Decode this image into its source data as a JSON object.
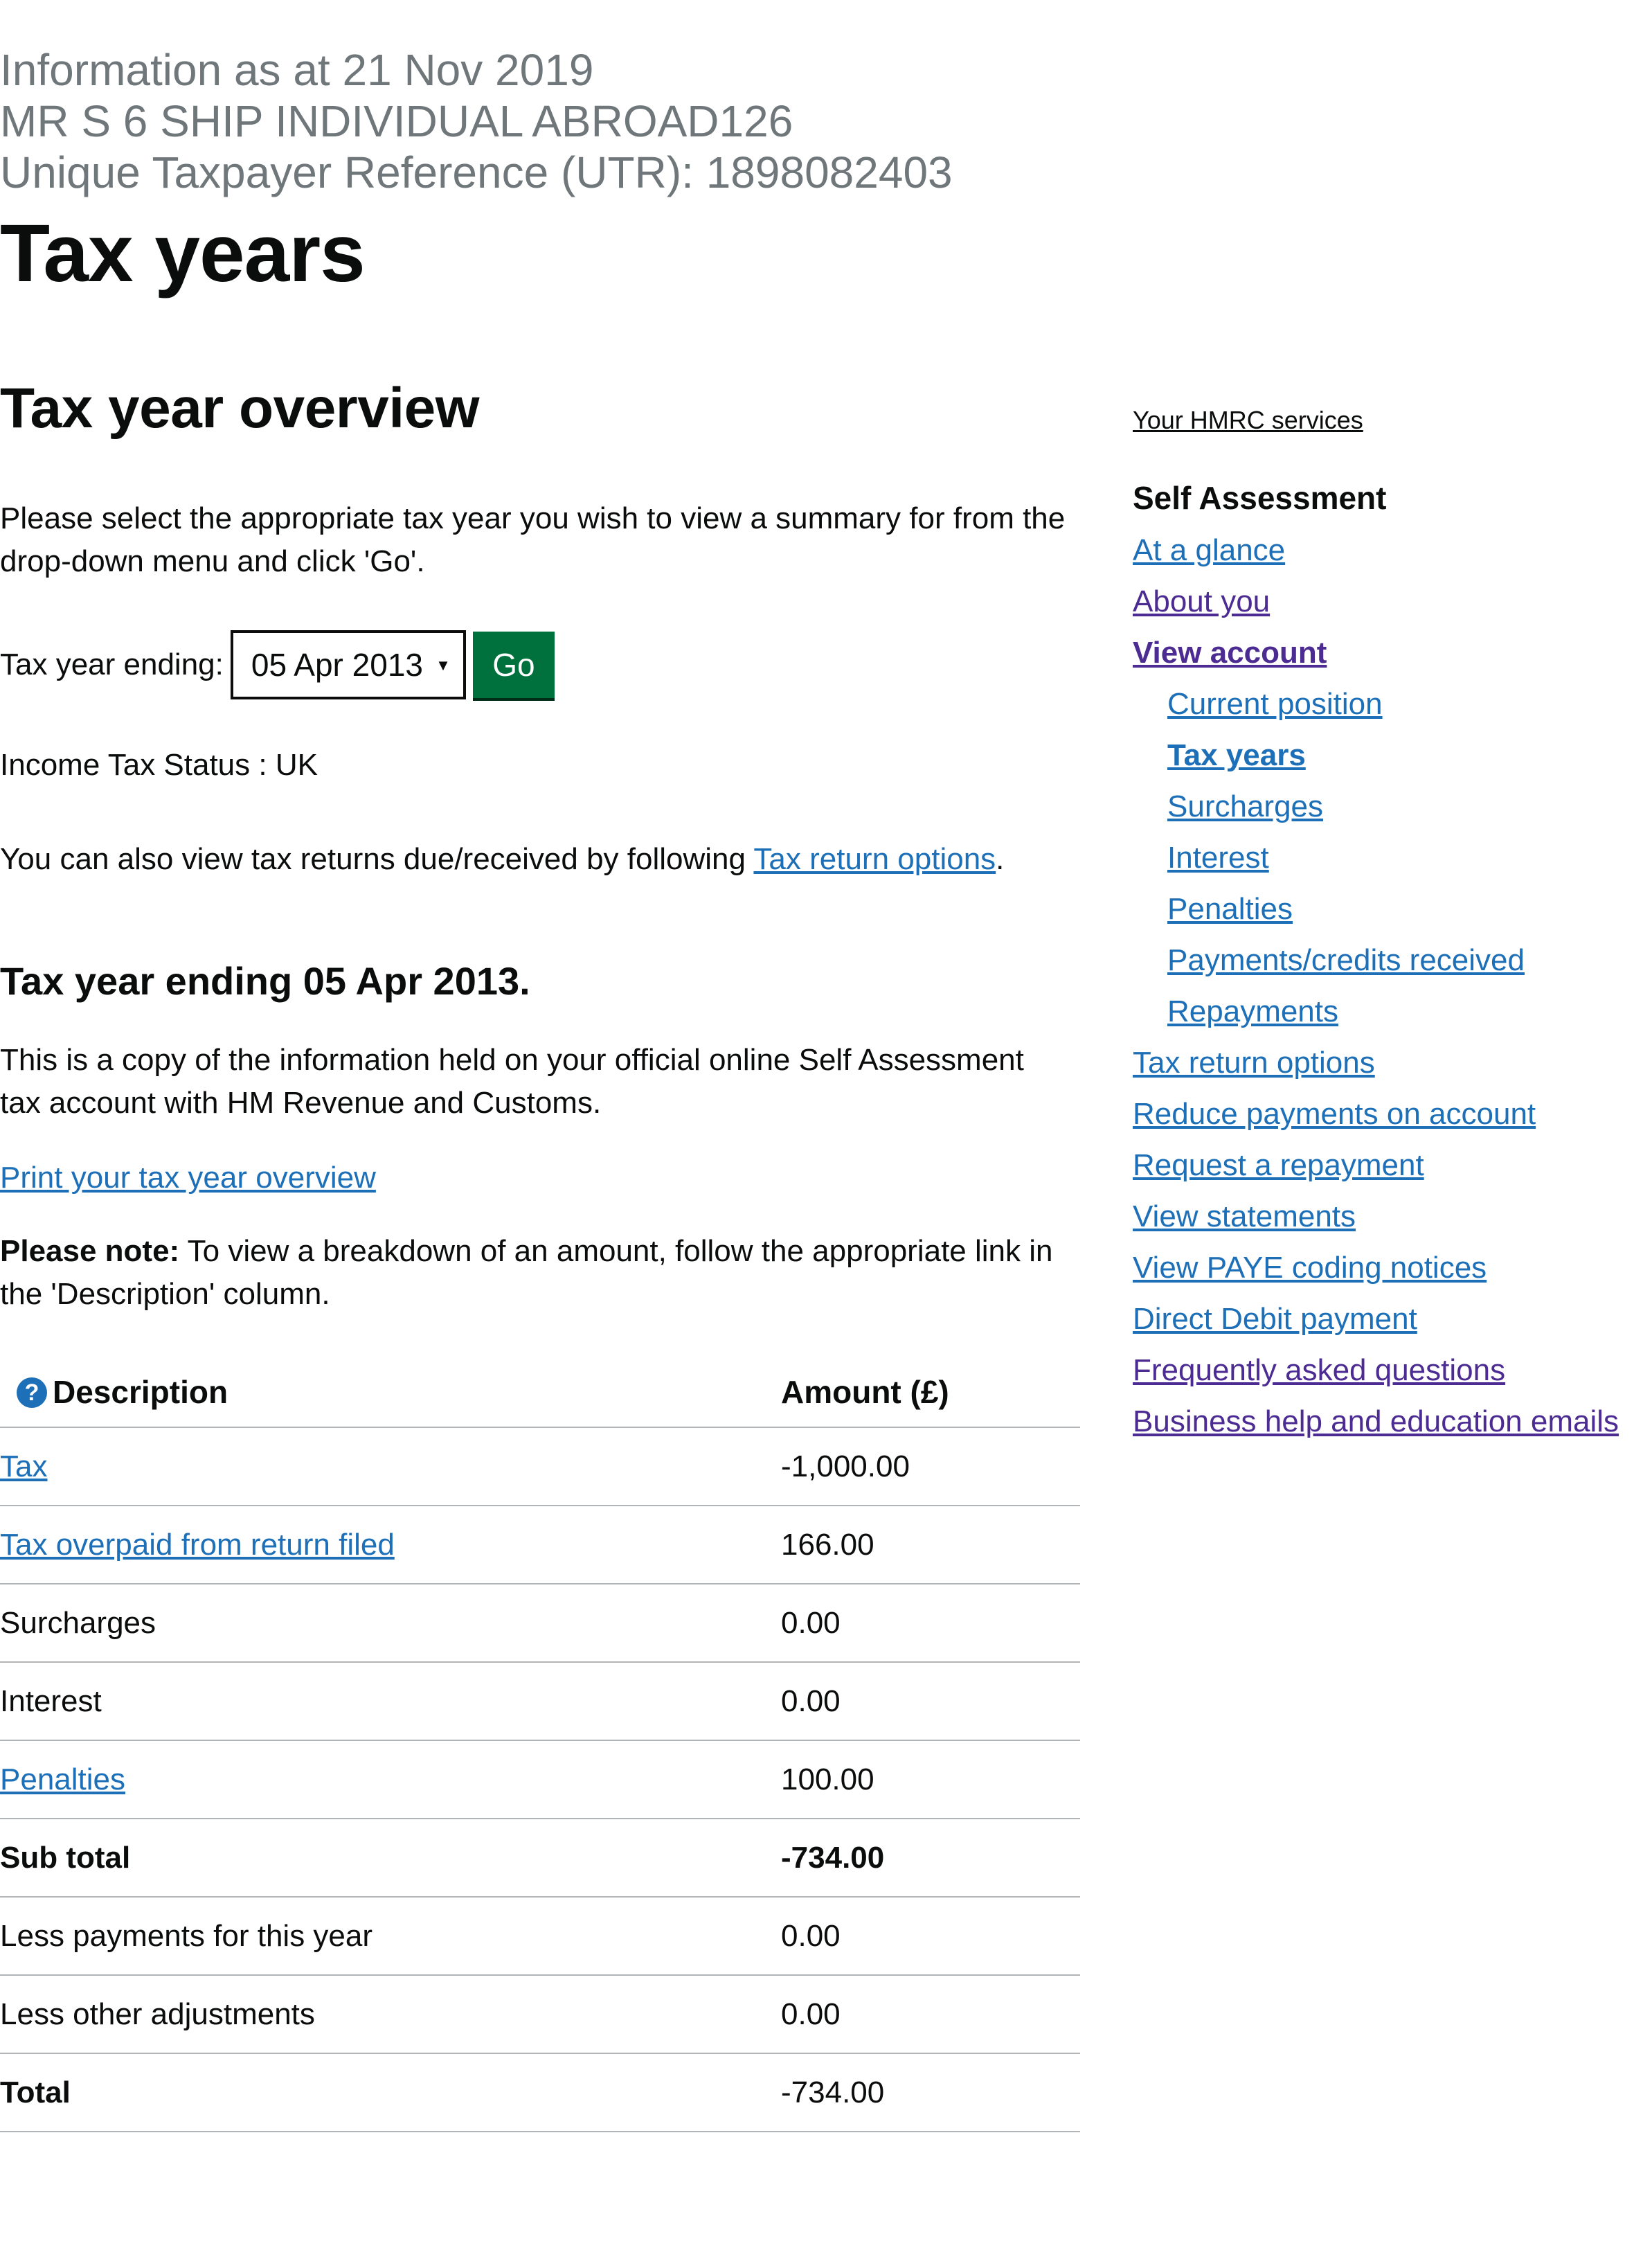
{
  "header": {
    "info_date": "Information as at 21 Nov 2019",
    "name": "MR S 6 SHIP INDIVIDUAL ABROAD126",
    "utr": "Unique Taxpayer Reference (UTR): 1898082403",
    "title": "Tax years"
  },
  "overview": {
    "heading": "Tax year overview",
    "intro": "Please select the appropriate tax year you wish to view a summary for from the drop-down menu and click 'Go'.",
    "form_label": "Tax year ending:",
    "selected_year": "05 Apr 2013",
    "go_label": "Go",
    "status": "Income Tax Status : UK",
    "also_text": "You can also view tax returns due/received by following ",
    "also_link": "Tax return options",
    "also_end": ".",
    "year_heading": "Tax year ending 05 Apr 2013.",
    "copy": "This is a copy of the information held on your official online Self Assessment tax account with HM Revenue and Customs.",
    "print_link": "Print your tax year overview",
    "note_label": "Please note:",
    "note_text": " To view a breakdown of an amount, follow the appropriate link in the 'Description' column."
  },
  "table": {
    "headers": {
      "description": "Description",
      "amount": "Amount (£)"
    },
    "rows": [
      {
        "description": "Tax",
        "amount": "-1,000.00"
      },
      {
        "description": "Tax overpaid from return filed",
        "amount": "166.00"
      },
      {
        "description": "Surcharges",
        "amount": "0.00"
      },
      {
        "description": "Interest",
        "amount": "0.00"
      },
      {
        "description": "Penalties",
        "amount": "100.00"
      },
      {
        "description": "Sub total",
        "amount": "-734.00"
      },
      {
        "description": "Less payments for this year",
        "amount": "0.00"
      },
      {
        "description": "Less other adjustments",
        "amount": "0.00"
      },
      {
        "description": "Total",
        "amount": "-734.00"
      }
    ]
  },
  "sidebar": {
    "services": "Your HMRC services",
    "heading": "Self Assessment",
    "items": [
      "At a glance",
      "About you",
      "View account",
      "Current position",
      "Tax years",
      "Surcharges",
      "Interest",
      "Penalties",
      "Payments/credits received",
      "Repayments",
      "Tax return options",
      "Reduce payments on account",
      "Request a repayment",
      "View statements",
      "View PAYE coding notices",
      "Direct Debit payment",
      "Frequently asked questions",
      "Business help and education emails"
    ]
  },
  "colors": {
    "link": "#1d70b8",
    "visited": "#4c2c92",
    "button": "#00703c",
    "caption": "#6f777b"
  }
}
